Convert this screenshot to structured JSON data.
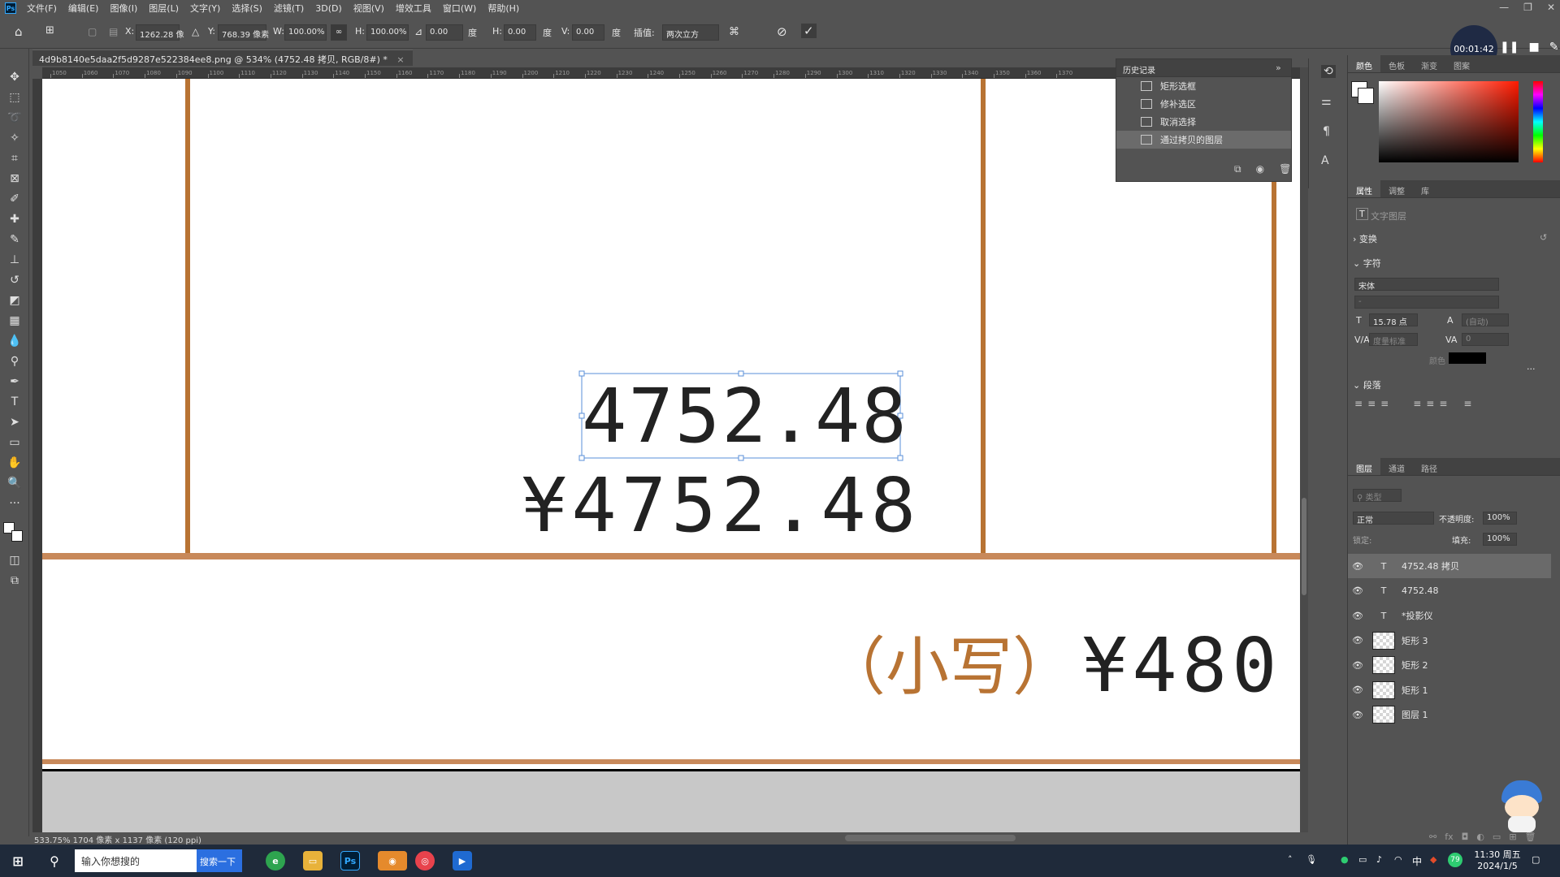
{
  "app": {
    "logo": "Ps",
    "menu": [
      "文件(F)",
      "编辑(E)",
      "图像(I)",
      "图层(L)",
      "文字(Y)",
      "选择(S)",
      "滤镜(T)",
      "3D(D)",
      "视图(V)",
      "增效工具",
      "窗口(W)",
      "帮助(H)"
    ]
  },
  "options": {
    "x_label": "X:",
    "x_value": "1262.28 像",
    "y_label": "Y:",
    "y_value": "768.39 像素",
    "w_label": "W:",
    "w_value": "100.00%",
    "h_label": "H:",
    "h_value": "100.00%",
    "angle_value": "0.00",
    "angle_unit": "度",
    "hskew_label": "H:",
    "hskew_value": "0.00",
    "hskew_unit": "度",
    "vskew_label": "V:",
    "vskew_value": "0.00",
    "vskew_unit": "度",
    "interp_label": "插值:",
    "interp_value": "两次立方"
  },
  "recorder": {
    "time": "00:01:42"
  },
  "document": {
    "tab_title": "4d9b8140e5daa2f5d9287e522384ee8.png @ 534% (4752.48 拷贝, RGB/8#) *",
    "ruler_h": [
      "1050",
      "1060",
      "1070",
      "1080",
      "1090",
      "1100",
      "1110",
      "1120",
      "1130",
      "1140",
      "1150",
      "1160",
      "1170",
      "1180",
      "1190",
      "1200",
      "1210",
      "1220",
      "1230",
      "1240",
      "1250",
      "1260",
      "1270",
      "1280",
      "1290",
      "1300",
      "1310",
      "1320",
      "1330",
      "1340",
      "1350",
      "1360",
      "1370"
    ],
    "status": "533.75%  1704 像素 x 1137 像素 (120 ppi)"
  },
  "canvas": {
    "selected_text": "4752.48",
    "amount_text": "¥4752.48",
    "lower_label": "（小写）",
    "lower_amount": "¥480"
  },
  "history": {
    "title": "历史记录",
    "items": [
      "矩形选框",
      "修补选区",
      "取消选择",
      "通过拷贝的图层"
    ]
  },
  "color_panel": {
    "tabs": [
      "颜色",
      "色板",
      "渐变",
      "图案"
    ]
  },
  "properties": {
    "tabs": [
      "属性",
      "调整",
      "库"
    ],
    "kind": "文字图层",
    "transform": "变换",
    "character": "字符",
    "font": "宋体",
    "font_style": "-",
    "size": "15.78 点",
    "leading": "(自动)",
    "tracking_label": "度量标准",
    "tracking": "0",
    "color_label": "颜色",
    "text_color": "#000000",
    "paragraph": "段落"
  },
  "layers": {
    "tabs": [
      "图层",
      "通道",
      "路径"
    ],
    "filter": "类型",
    "blend": "正常",
    "opacity_label": "不透明度:",
    "opacity": "100%",
    "lock_label": "锁定:",
    "fill_label": "填充:",
    "fill": "100%",
    "rows": [
      {
        "name": "4752.48 拷贝",
        "type": "T"
      },
      {
        "name": "4752.48",
        "type": "T"
      },
      {
        "name": "*投影仪",
        "type": "T"
      },
      {
        "name": "矩形 3",
        "type": "img"
      },
      {
        "name": "矩形 2",
        "type": "img"
      },
      {
        "name": "矩形 1",
        "type": "img"
      },
      {
        "name": "图层 1",
        "type": "img"
      }
    ]
  },
  "taskbar": {
    "search_placeholder": "输入你想搜的",
    "search_button": "搜索一下",
    "ime": "中",
    "time": "11:30 周五",
    "date": "2024/1/5",
    "battery": "79"
  },
  "colors": {
    "border_brown": "#b87333",
    "accent": "#31a8ff"
  }
}
